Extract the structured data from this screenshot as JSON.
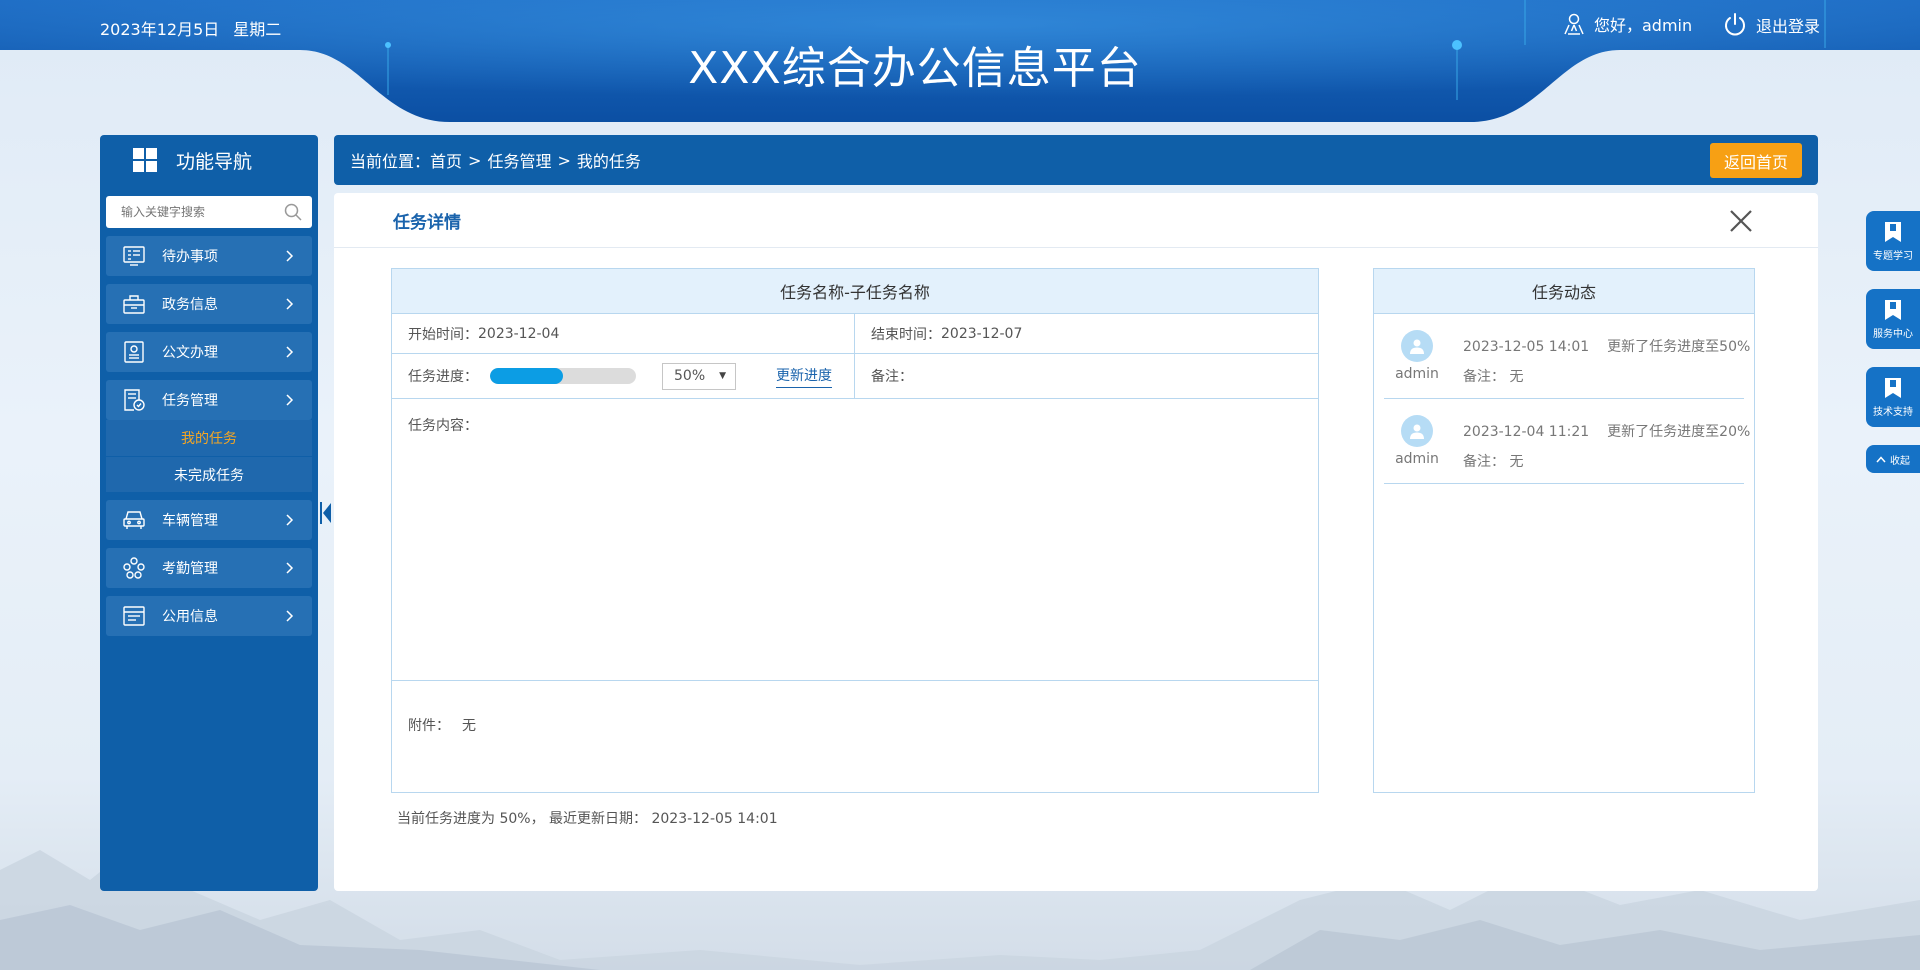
{
  "header": {
    "date": "2023年12月5日",
    "weekday": "星期二",
    "title": "XXX综合办公信息平台",
    "greeting": "您好，admin",
    "logout": "退出登录"
  },
  "sidebar": {
    "title": "功能导航",
    "search_placeholder": "输入关键字搜索",
    "items": [
      {
        "label": "待办事项",
        "icon": "todo-icon"
      },
      {
        "label": "政务信息",
        "icon": "briefcase-icon"
      },
      {
        "label": "公文办理",
        "icon": "document-seal-icon"
      },
      {
        "label": "任务管理",
        "icon": "task-icon",
        "expanded": true,
        "children": [
          {
            "label": "我的任务",
            "active": true
          },
          {
            "label": "未完成任务",
            "active": false
          }
        ]
      },
      {
        "label": "车辆管理",
        "icon": "car-icon"
      },
      {
        "label": "考勤管理",
        "icon": "attendance-icon"
      },
      {
        "label": "公用信息",
        "icon": "info-doc-icon"
      }
    ]
  },
  "breadcrumb": {
    "prefix": "当前位置：",
    "path": [
      "首页",
      "任务管理",
      "我的任务"
    ],
    "separator": ">",
    "home_button": "返回首页"
  },
  "detail": {
    "title": "任务详情",
    "task_name": "任务名称-子任务名称",
    "start_label": "开始时间：",
    "start_value": "2023-12-04",
    "end_label": "结束时间：",
    "end_value": "2023-12-07",
    "progress_label": "任务进度：",
    "progress_fraction": 0.5,
    "progress_select": "50%",
    "update_link": "更新进度",
    "remark_label": "备注：",
    "content_label": "任务内容：",
    "attach_label": "附件：",
    "attach_value": "无",
    "footer": "当前任务进度为 50%， 最近更新日期： 2023-12-05 14:01"
  },
  "activity": {
    "title": "任务动态",
    "items": [
      {
        "user": "admin",
        "time": "2023-12-05 14:01",
        "desc": "更新了任务进度至50%",
        "remark": "备注：  无"
      },
      {
        "user": "admin",
        "time": "2023-12-04  11:21",
        "desc": "更新了任务进度至20%",
        "remark": "备注：  无"
      }
    ]
  },
  "float_bar": {
    "buttons": [
      "专题学习",
      "服务中心",
      "技术支持"
    ],
    "collapse": "收起"
  },
  "colors": {
    "primary": "#0f5fa8",
    "accent": "#f7a014",
    "progress": "#0c9de4",
    "active_sub": "#f5a623"
  }
}
